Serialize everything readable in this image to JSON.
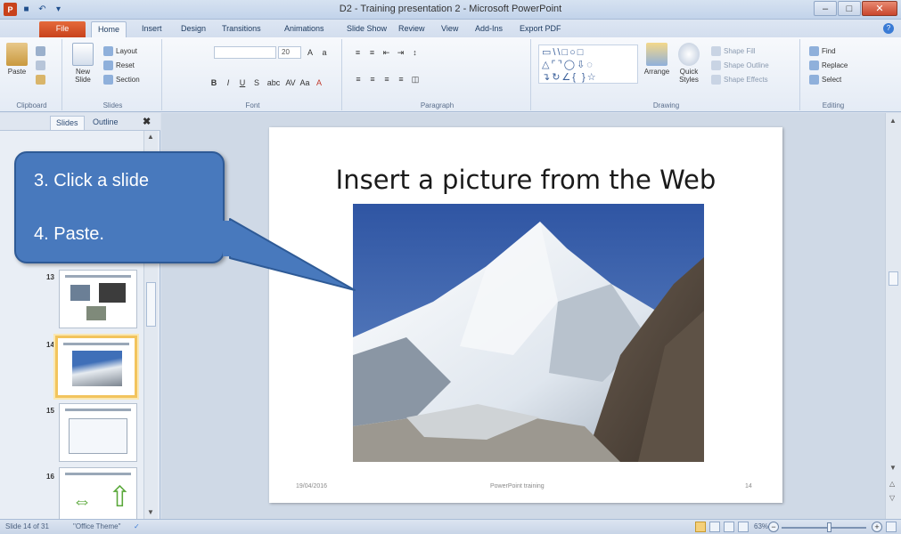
{
  "window": {
    "title": "D2 - Training presentation 2 - Microsoft PowerPoint",
    "qat_icons": [
      "powerpoint-icon",
      "save-icon",
      "undo-icon",
      "customize-icon"
    ]
  },
  "tabs": [
    {
      "label": "File"
    },
    {
      "label": "Home"
    },
    {
      "label": "Insert"
    },
    {
      "label": "Design"
    },
    {
      "label": "Transitions"
    },
    {
      "label": "Animations"
    },
    {
      "label": "Slide Show"
    },
    {
      "label": "Review"
    },
    {
      "label": "View"
    },
    {
      "label": "Add-Ins"
    },
    {
      "label": "Export PDF"
    }
  ],
  "ribbon": {
    "clipboard": {
      "label": "Clipboard",
      "paste": "Paste"
    },
    "slides": {
      "label": "Slides",
      "new_slide": "New Slide",
      "layout": "Layout",
      "reset": "Reset",
      "section": "Section"
    },
    "font": {
      "label": "Font",
      "size": "20",
      "format_buttons": [
        "B",
        "I",
        "U",
        "S",
        "abc",
        "AV",
        "Aa",
        "A"
      ]
    },
    "paragraph": {
      "label": "Paragraph"
    },
    "drawing": {
      "label": "Drawing",
      "arrange": "Arrange",
      "quick_styles": "Quick Styles",
      "shape_fill": "Shape Fill",
      "shape_outline": "Shape Outline",
      "shape_effects": "Shape Effects"
    },
    "editing": {
      "label": "Editing",
      "find": "Find",
      "replace": "Replace",
      "select": "Select"
    }
  },
  "slides_pane": {
    "tabs": [
      "Slides",
      "Outline"
    ],
    "thumbnails": [
      {
        "number": "13",
        "title": "Insert a picture from a file"
      },
      {
        "number": "14",
        "title": "Insert a picture from the Web",
        "selected": true
      },
      {
        "number": "15",
        "title": "Insert Screenshot"
      },
      {
        "number": "16",
        "title": "Add a SmartArt diagram"
      }
    ]
  },
  "slide": {
    "title": "Insert a picture from the Web",
    "footer_date": "19/04/2016",
    "footer_text": "PowerPoint training",
    "footer_page": "14"
  },
  "callout": {
    "line1": "3. Click a slide",
    "line2": "4. Paste."
  },
  "status": {
    "slide_info": "Slide 14 of 31",
    "theme": "\"Office Theme\"",
    "zoom": "63%"
  },
  "colors": {
    "callout_fill": "#4879bd",
    "file_tab": "#c8421c",
    "selected_thumb": "#f2c45d"
  }
}
